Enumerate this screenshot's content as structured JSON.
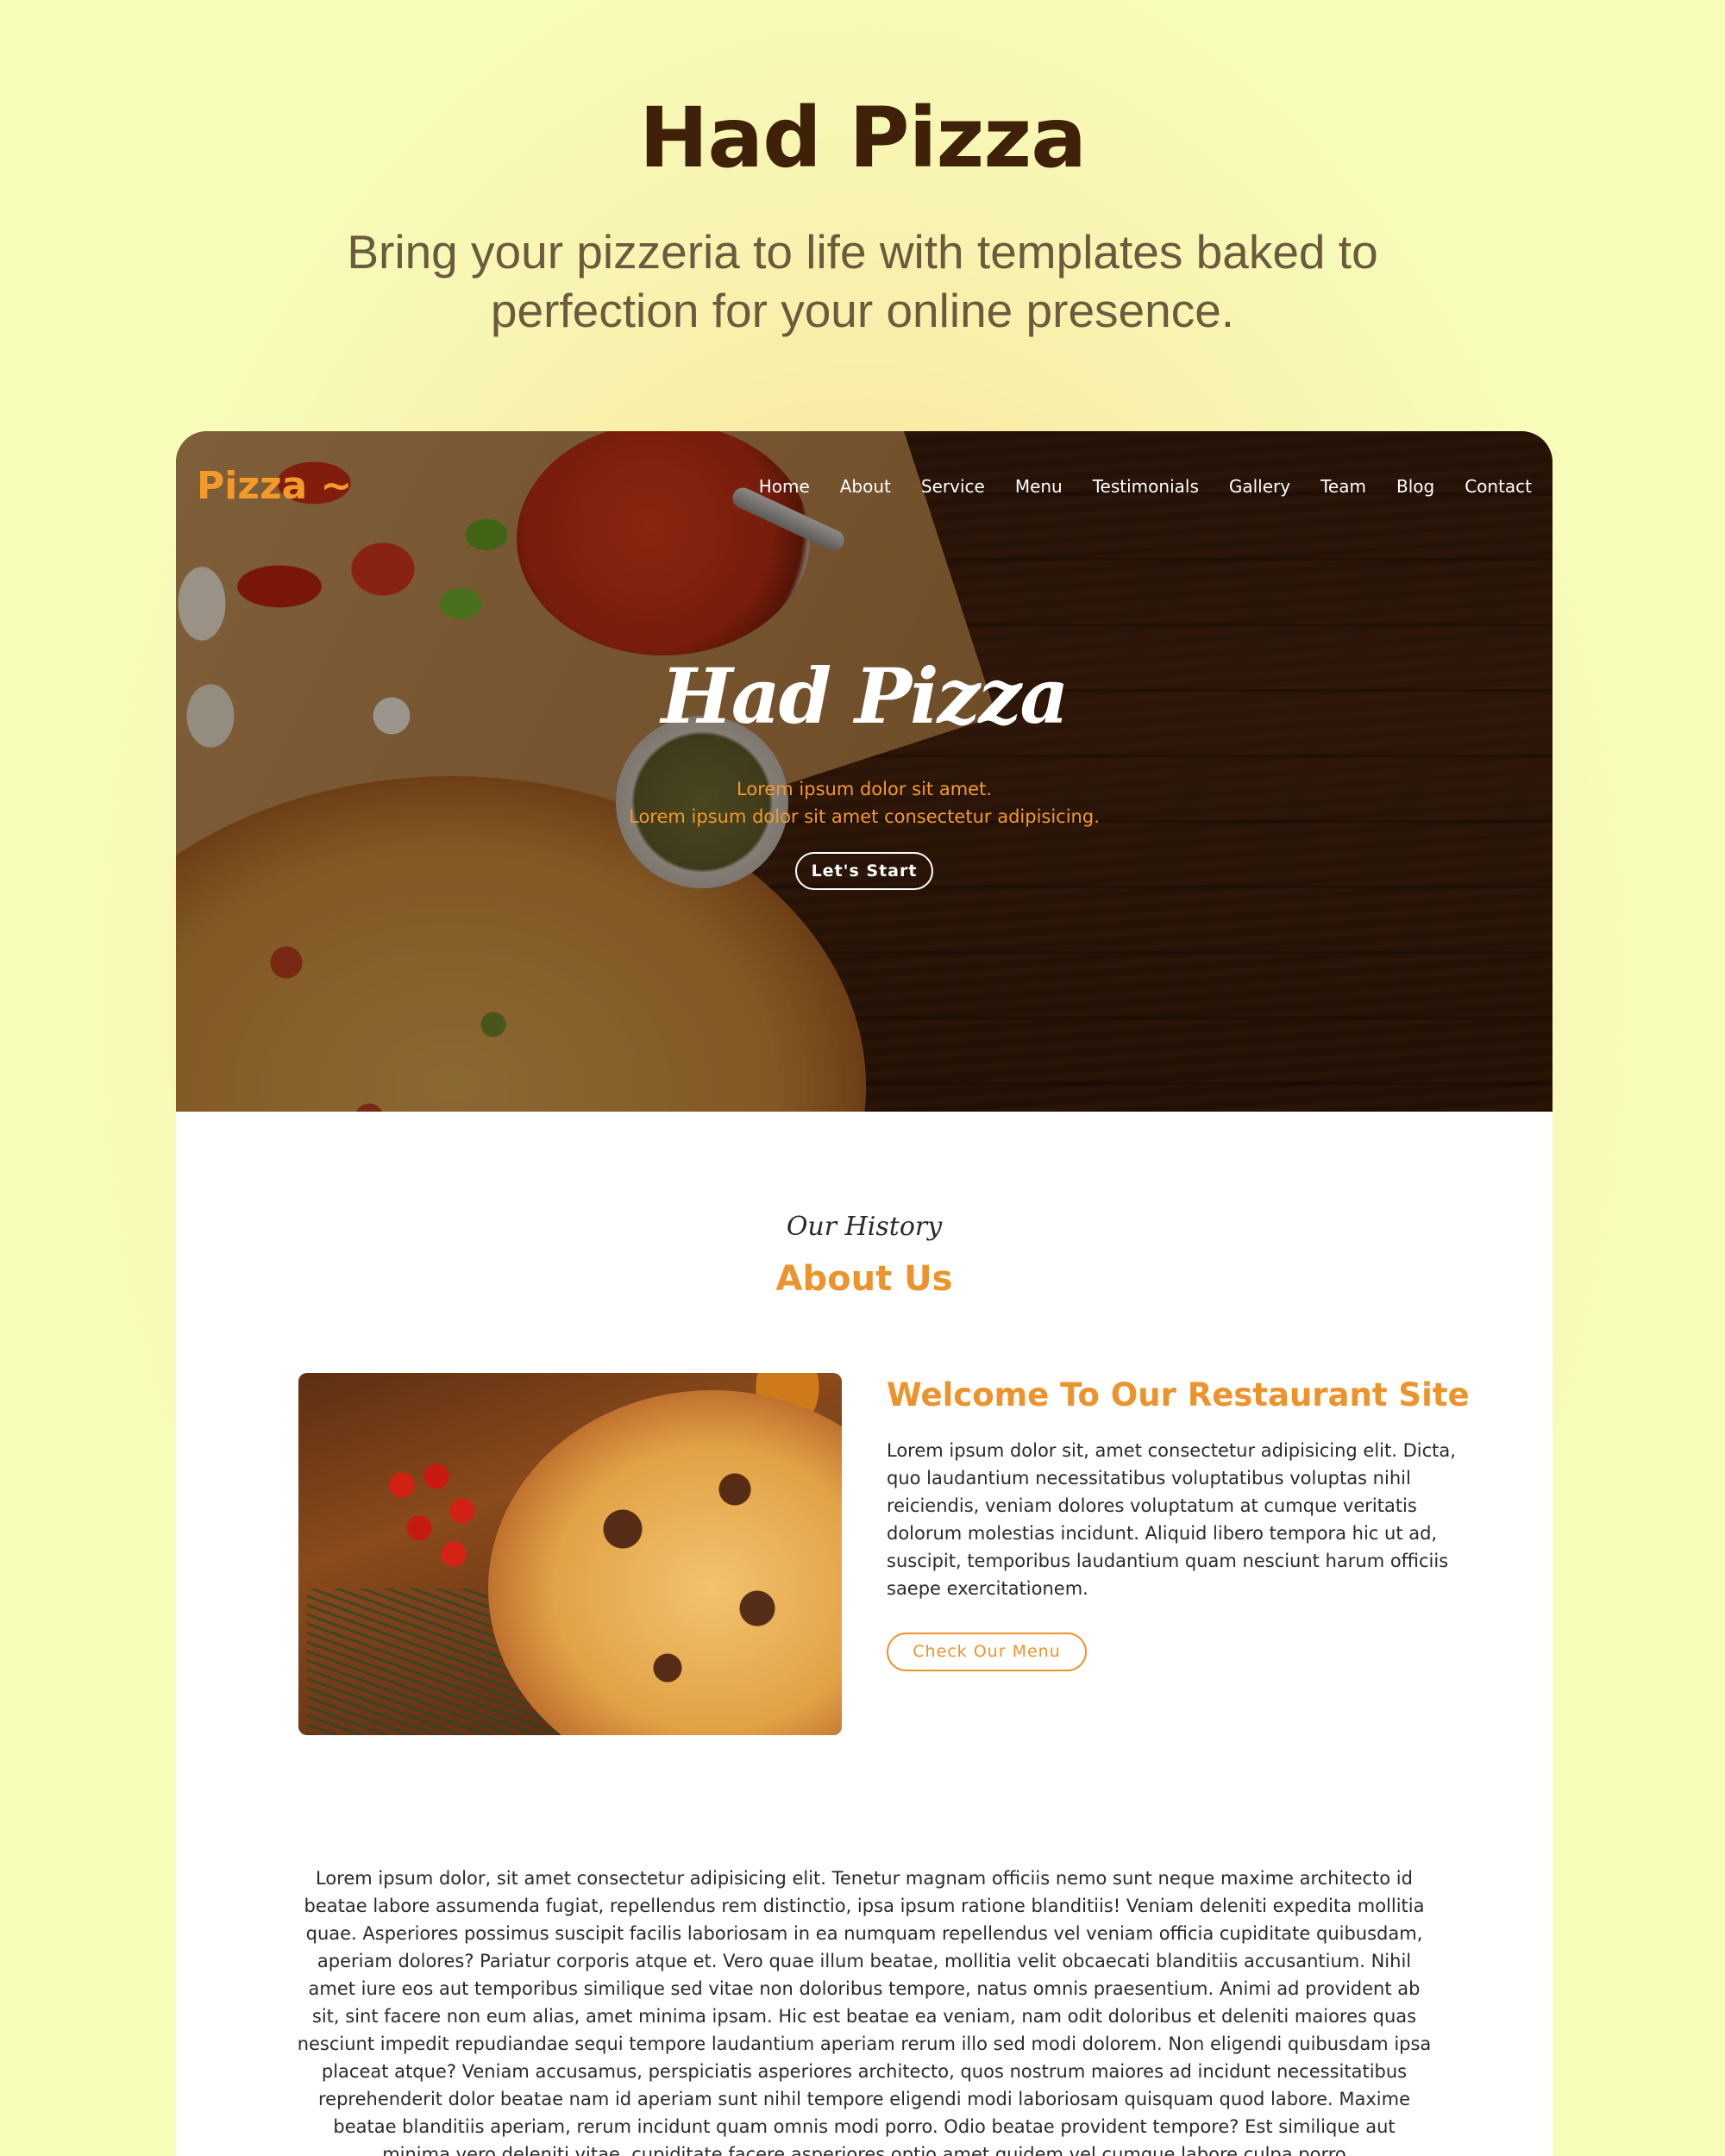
{
  "header": {
    "title": "Had Pizza",
    "subtitle": "Bring your pizzeria to life with templates baked to perfection for your online presence."
  },
  "site": {
    "logo": "Pizza ~",
    "nav": [
      "Home",
      "About",
      "Service",
      "Menu",
      "Testimonials",
      "Gallery",
      "Team",
      "Blog",
      "Contact"
    ],
    "hero": {
      "title": "Had Pizza",
      "line1": "Lorem ipsum dolor sit amet.",
      "line2": "Lorem ipsum dolor sit amet consectetur adipisicing.",
      "cta": "Let's Start"
    },
    "about": {
      "kicker": "Our History",
      "heading": "About Us",
      "welcome_title": "Welcome To Our Restaurant Site",
      "welcome_text": "Lorem ipsum dolor sit, amet consectetur adipisicing elit. Dicta, quo laudantium necessitatibus voluptatibus voluptas nihil reiciendis, veniam dolores voluptatum at cumque veritatis dolorum molestias incidunt. Aliquid libero tempora hic ut ad, suscipit, temporibus laudantium quam nesciunt harum officiis saepe exercitationem.",
      "menu_button": "Check Our Menu",
      "paragraph": "Lorem ipsum dolor, sit amet consectetur adipisicing elit. Tenetur magnam officiis nemo sunt neque maxime architecto id beatae labore assumenda fugiat, repellendus rem distinctio, ipsa ipsum ratione blanditiis! Veniam deleniti expedita mollitia quae. Asperiores possimus suscipit facilis laboriosam in ea numquam repellendus vel veniam officia cupiditate quibusdam, aperiam dolores? Pariatur corporis atque et. Vero quae illum beatae, mollitia velit obcaecati blanditiis accusantium. Nihil amet iure eos aut temporibus similique sed vitae non doloribus tempore, natus omnis praesentium. Animi ad provident ab sit, sint facere non eum alias, amet minima ipsam. Hic est beatae ea veniam, nam odit doloribus et deleniti maiores quas nesciunt impedit repudiandae sequi tempore laudantium aperiam rerum illo sed modi dolorem. Non eligendi quibusdam ipsa placeat atque? Veniam accusamus, perspiciatis asperiores architecto, quos nostrum maiores ad incidunt necessitatibus reprehenderit dolor beatae nam id aperiam sunt nihil tempore eligendi modi laboriosam quisquam quod labore. Maxime beatae blanditiis aperiam, rerum incidunt quam omnis modi porro. Odio beatae provident tempore? Est similique aut minima vero deleniti vitae, cupiditate facere asperiores optio amet quidem vel cumque labore culpa porro"
    }
  },
  "colors": {
    "page_bg": "#f7fcb8",
    "title": "#3e2108",
    "accent": "#ec932c",
    "text": "#2a2a2a"
  }
}
